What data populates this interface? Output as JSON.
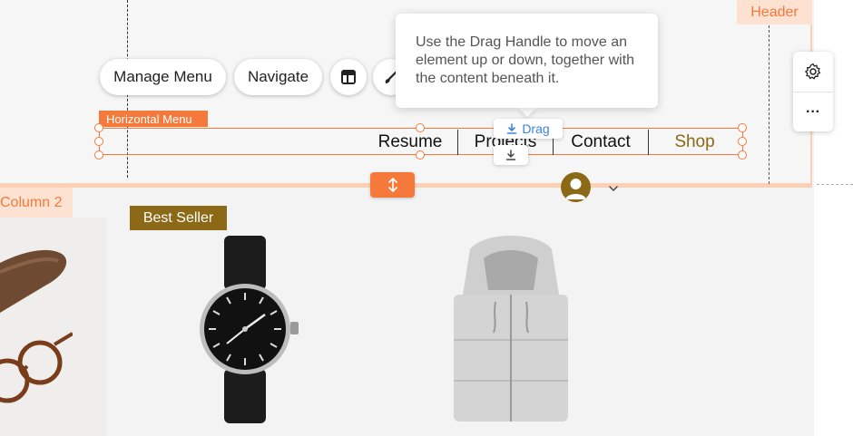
{
  "header": {
    "tag": "Header"
  },
  "toolbar": {
    "manage_menu": "Manage Menu",
    "navigate": "Navigate",
    "layout_icon": "layout-icon",
    "design_icon": "paintbrush-icon"
  },
  "tooltip": {
    "text": "Use the Drag Handle to move an element up or down, together with the content beneath it."
  },
  "horizontal_menu": {
    "label": "Horizontal Menu",
    "items": [
      "Resume",
      "Projects",
      "Contact",
      "Shop"
    ]
  },
  "drag": {
    "label": "Drag",
    "icon": "download-arrow-icon"
  },
  "side_panel": {
    "settings_icon": "gear-icon",
    "more_label": "···"
  },
  "content": {
    "column_tag": "Column 2",
    "badge": "Best Seller"
  },
  "colors": {
    "accent": "#f5793a",
    "accent_light": "#fde2d2",
    "brand_gold": "#8b6916",
    "link_blue": "#3b82e0"
  }
}
